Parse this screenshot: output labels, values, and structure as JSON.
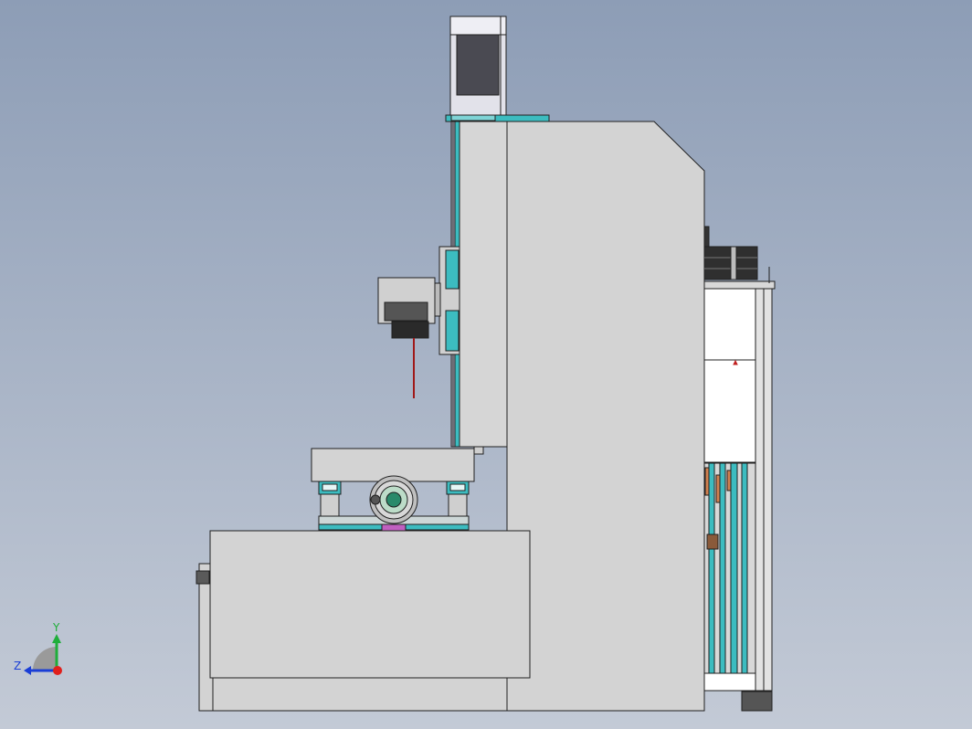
{
  "view": {
    "background_top": "#8d9db6",
    "background_bottom": "#c3cad6"
  },
  "triad": {
    "y_label": "Y",
    "z_label": "Z",
    "x_axis_color": "#e0201c",
    "y_axis_color": "#1fae3a",
    "z_axis_color": "#1a3ed6"
  },
  "colors": {
    "body": "#d3d3d3",
    "body_dark": "#bdbdbd",
    "edge": "#202020",
    "accent_teal": "#3cbcc0",
    "motor_dark": "#4a4a52",
    "laser_beam": "#a01818",
    "lens_dark": "#2a2a2a"
  }
}
